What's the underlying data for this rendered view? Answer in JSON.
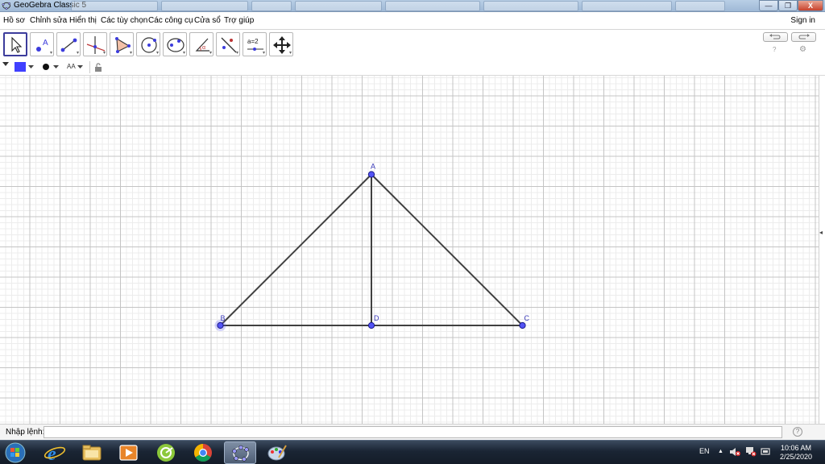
{
  "window": {
    "title": "GeoGebra Classic 5",
    "controls": {
      "minimize": "—",
      "maximize": "❐",
      "close": "X"
    }
  },
  "menubar": {
    "items": [
      "Hồ sơ",
      "Chỉnh sửa",
      "Hiển thị",
      "Các tùy chọn",
      "Các công cụ",
      "Cửa sổ",
      "Trợ giúp"
    ],
    "signin": "Sign in"
  },
  "toolbar": {
    "tools": [
      "move",
      "point",
      "line",
      "perpendicular-line",
      "polygon",
      "circle",
      "conic",
      "angle",
      "reflect",
      "slider",
      "move-graphics-view"
    ],
    "slider_label": "a=2",
    "undo_icon": "undo-icon",
    "redo_icon": "redo-icon",
    "help_icon": "?",
    "settings_icon": "⚙"
  },
  "stylebar": {
    "color": "#4040ff",
    "font_size_label": "AA"
  },
  "colors": {
    "point_fill": "#5454f5",
    "point_stroke": "#1a1a8c",
    "segment": "#404040",
    "label": "#3838b8"
  },
  "geometry": {
    "points": [
      {
        "name": "A",
        "x": 0,
        "y": 5
      },
      {
        "name": "B",
        "x": -5,
        "y": 0
      },
      {
        "name": "C",
        "x": 5,
        "y": 0
      },
      {
        "name": "D",
        "x": 0,
        "y": 0
      }
    ],
    "segments": [
      [
        "A",
        "B"
      ],
      [
        "A",
        "C"
      ],
      [
        "B",
        "C"
      ],
      [
        "A",
        "D"
      ]
    ],
    "selected_point": "B"
  },
  "inputbar": {
    "label": "Nhập lệnh:",
    "value": "",
    "help": "?"
  },
  "taskbar": {
    "apps": [
      "start",
      "internet-explorer",
      "file-explorer",
      "media-player",
      "app-green",
      "chrome",
      "geogebra",
      "paint"
    ],
    "active_app": "geogebra",
    "language": "EN",
    "time": "10:06 AM",
    "date": "2/25/2020"
  }
}
